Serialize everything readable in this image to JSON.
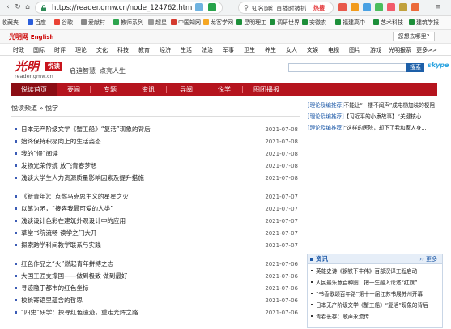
{
  "browser": {
    "url": "https://reader.gmw.cn/node_124762.htm",
    "search_text": "知名网红直播时被抓",
    "hot_label": "热搜",
    "bookmarks": [
      "收藏夹",
      "百度",
      "谷歌",
      "爱献村",
      "教师系列",
      "超星",
      "中国知网",
      "龙客学网",
      "昆明理工",
      "调研世界",
      "安徽农",
      "福建高中",
      "艺术科技",
      "建筑学报"
    ]
  },
  "site_top": {
    "lang": "English",
    "login": "您想去哪里?"
  },
  "channels": [
    "时政",
    "国际",
    "时评",
    "理论",
    "文化",
    "科技",
    "教育",
    "经济",
    "生活",
    "法治",
    "军事",
    "卫生",
    "养生",
    "女人",
    "文娱",
    "电视",
    "图片",
    "游戏",
    "光明报系",
    "更多>>"
  ],
  "header": {
    "logo_cn": "光明",
    "logo_box": "悦读",
    "logo_url": "reader.gmw.cn",
    "links": [
      "启迪智慧",
      "点亮人生"
    ],
    "search_btn": "搜索",
    "skype": "skype"
  },
  "red_nav": [
    "悦读首页",
    "要闻",
    "专题",
    "资讯",
    "导阅",
    "悦学",
    "图团播报"
  ],
  "breadcrumb": "悦读频道 » 悦学",
  "articles": [
    {
      "title": "日本无产阶级文学《蟹工船》“复活”现象的背后",
      "date": "2021-07-08"
    },
    {
      "title": "始终保持积极向上的生活姿态",
      "date": "2021-07-08"
    },
    {
      "title": "我的“慢”阅读",
      "date": "2021-07-08"
    },
    {
      "title": "发扬光荣传统 放飞青春梦想",
      "date": "2021-07-08"
    },
    {
      "title": "浅谈大学生人力资源质量影响因素及提升措施",
      "date": "2021-07-08"
    },
    {
      "title": "《新青年》：点燃马克思主义的星星之火",
      "date": "2021-07-07"
    },
    {
      "title": "以笔为矛，“接容我最可爱的人类”",
      "date": "2021-07-07"
    },
    {
      "title": "浅谈设计色彩在建筑外观设计中的应用",
      "date": "2021-07-07"
    },
    {
      "title": "草堂书院流畅 读学之门大开",
      "date": "2021-07-07"
    },
    {
      "title": "探索跨学科间教学联系与实践",
      "date": "2021-07-07"
    },
    {
      "title": "红色作品之“火”燃起青年拼搏之志",
      "date": "2021-07-06"
    },
    {
      "title": "大国工匠支撑国——做到极致 做到最好",
      "date": "2021-07-06"
    },
    {
      "title": "寻迹隐于都市的红色坐标",
      "date": "2021-07-06"
    },
    {
      "title": "校长寄语里蕴含的哲思",
      "date": "2021-07-06"
    },
    {
      "title": "“四史”研学：探寻红色遗迹，重走光辉之路",
      "date": "2021-07-06"
    }
  ],
  "right_items": [
    {
      "tag": "[理论及编推荐]",
      "text": "不能让“一楼不闻声”成电梯加装的梗阻"
    },
    {
      "tag": "[理论及编推荐]",
      "text": "【习近平的小康故事】“关键核心..."
    },
    {
      "tag": "[理论及编推荐]",
      "text": "“这样的医院，却下了我和家人身..."
    }
  ],
  "panel": {
    "title": "资讯",
    "more": "更多",
    "items": [
      "英雄史诗《钢铁下丰伟》百部汉译工程启动",
      "人民最乐意百种图：把一生融入论述“红旗”",
      "“书香歌颂百年路”第十一届江苏书展苏州开幕",
      "日本无产阶级文学《蟹工船》“复活”现象的背后",
      "青春长存：歌声永流传"
    ]
  },
  "colors": {
    "brand_red": "#b5141e",
    "link_blue": "#1e5aa8"
  }
}
